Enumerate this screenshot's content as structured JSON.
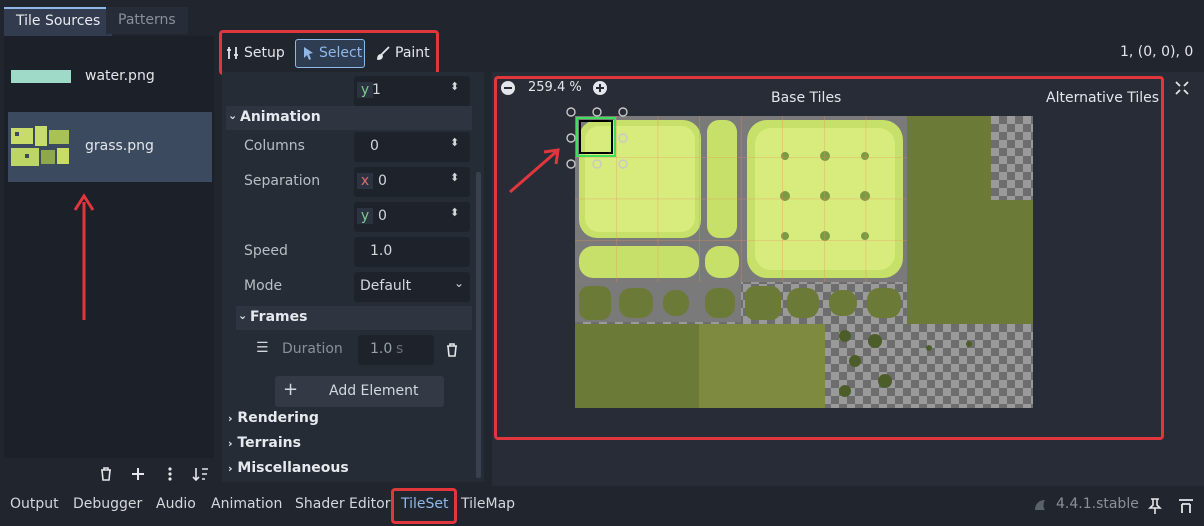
{
  "tabs": {
    "tile_sources": "Tile Sources",
    "patterns": "Patterns"
  },
  "sources": [
    {
      "label": "water.png",
      "selected": false,
      "swatch_color": "#9fd9c8"
    },
    {
      "label": "grass.png",
      "selected": true,
      "swatch_color": "#c8dc6a"
    }
  ],
  "toolbar": {
    "setup": "Setup",
    "select": "Select",
    "paint": "Paint",
    "coords": "1, (0, 0), 0"
  },
  "inspector": {
    "top_y_axis": "y",
    "top_y_value": "1",
    "animation_header": "Animation",
    "columns_label": "Columns",
    "columns_value": "0",
    "separation_label": "Separation",
    "separation_x_axis": "x",
    "separation_x_value": "0",
    "separation_y_axis": "y",
    "separation_y_value": "0",
    "speed_label": "Speed",
    "speed_value": "1.0",
    "mode_label": "Mode",
    "mode_value": "Default",
    "frames_header": "Frames",
    "duration_label": "Duration",
    "duration_value": "1.0",
    "duration_unit": "s",
    "add_element": "Add Element",
    "rendering": "Rendering",
    "terrains": "Terrains",
    "miscellaneous": "Miscellaneous"
  },
  "viewport": {
    "zoom": "259.4 %",
    "base_tiles": "Base Tiles",
    "alternative_tiles": "Alternative Tiles"
  },
  "bottom_tabs": [
    "Output",
    "Debugger",
    "Audio",
    "Animation",
    "Shader Editor",
    "TileSet",
    "TileMap"
  ],
  "active_bottom_tab": "TileSet",
  "version": "4.4.1.stable",
  "colors": {
    "accent": "#8fb8e8",
    "highlight_box": "#e2363d",
    "selected_tile": "#3ee05a",
    "grass_light": "#c8e06a",
    "grass_dark": "#6b7a36"
  }
}
